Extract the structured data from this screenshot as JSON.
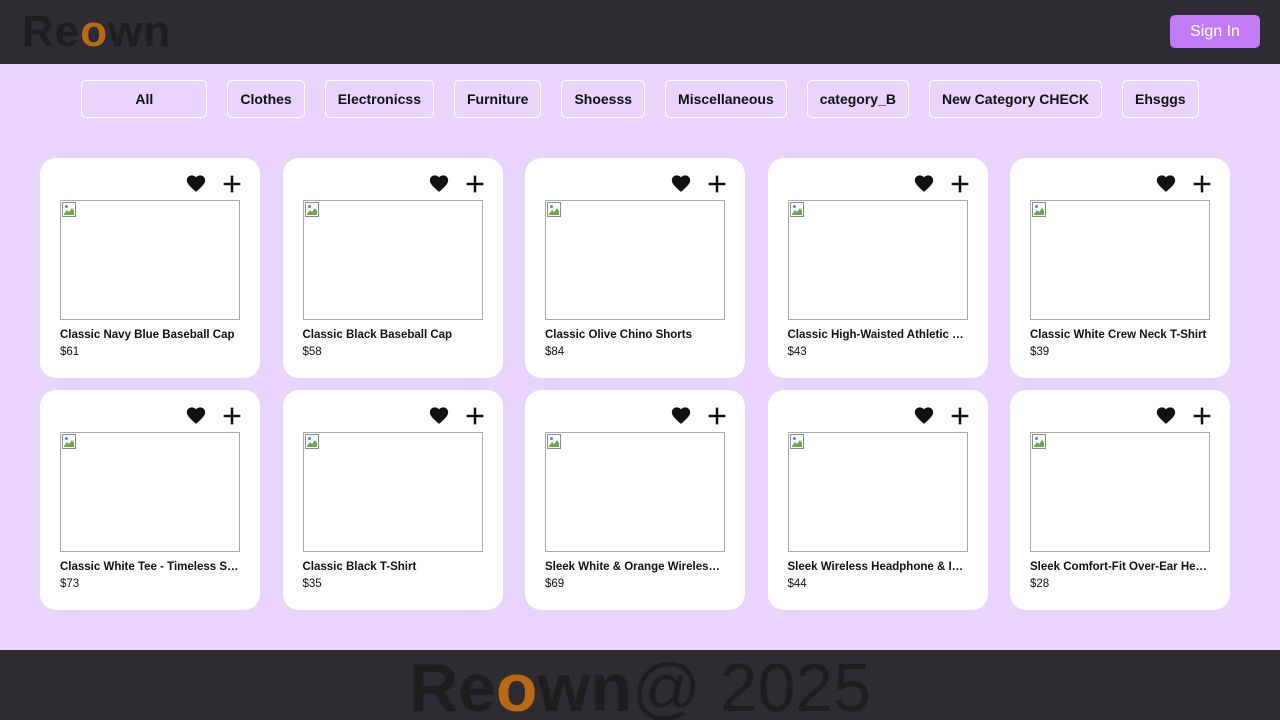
{
  "header": {
    "logo": {
      "pre": "Re",
      "accent": "o",
      "post": "wn"
    },
    "signin_label": "Sign In"
  },
  "categories": [
    "All",
    "Clothes",
    "Electronicss",
    "Furniture",
    "Shoesss",
    "Miscellaneous",
    "category_B",
    "New Category CHECK",
    "Ehsggs"
  ],
  "products": [
    {
      "title": "Classic Navy Blue Baseball Cap",
      "price": "$61"
    },
    {
      "title": "Classic Black Baseball Cap",
      "price": "$58"
    },
    {
      "title": "Classic Olive Chino Shorts",
      "price": "$84"
    },
    {
      "title": "Classic High-Waisted Athletic Joggers",
      "price": "$43"
    },
    {
      "title": "Classic White Crew Neck T-Shirt",
      "price": "$39"
    },
    {
      "title": "Classic White Tee - Timeless Style",
      "price": "$73"
    },
    {
      "title": "Classic Black T-Shirt",
      "price": "$35"
    },
    {
      "title": "Sleek White & Orange Wireless Gaming Controller",
      "price": "$69"
    },
    {
      "title": "Sleek Wireless Headphone & Inked Earbud Set",
      "price": "$44"
    },
    {
      "title": "Sleek Comfort-Fit Over-Ear Headphones",
      "price": "$28"
    }
  ],
  "footer": {
    "logo": {
      "pre": "Re",
      "accent": "o",
      "post": "wn"
    },
    "copyright": "@ 2025"
  },
  "colors": {
    "background": "#e8d4fc",
    "header_bg": "#2e2b33",
    "accent_o": "#b86a12",
    "signin_bg": "#c27bf5"
  },
  "icons": {
    "favorite": "heart-icon",
    "add": "plus-icon",
    "image_placeholder": "broken-image-icon"
  }
}
